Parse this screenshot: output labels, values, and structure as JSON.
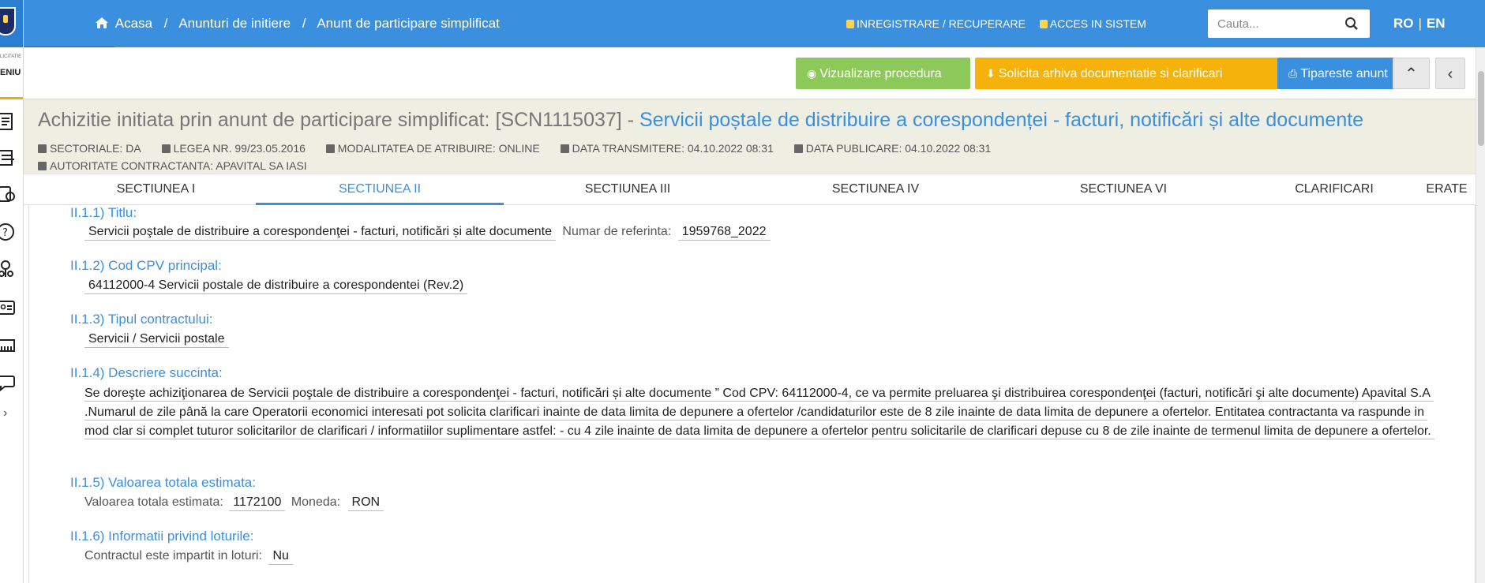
{
  "sidebar": {
    "top_label": "LICITATIE",
    "menu_label": "ENIU",
    "icons": [
      "document-icon",
      "list-icon",
      "tasks-icon",
      "help-icon",
      "tree-icon",
      "id-card-icon",
      "ruler-icon",
      "chat-icon"
    ],
    "expand": "›"
  },
  "topbar": {
    "breadcrumb": [
      {
        "label": "Acasa"
      },
      {
        "label": "Anunturi de initiere"
      },
      {
        "label": "Anunt de participare simplificat"
      }
    ],
    "separator": "/",
    "register_link": "INREGISTRARE / RECUPERARE",
    "login_link": "ACCES IN SISTEM",
    "search_placeholder": "Cauta...",
    "lang_ro": "RO",
    "lang_sep": "|",
    "lang_en": "EN"
  },
  "actions": {
    "view_procedure": "Vizualizare procedura",
    "request_archive": "Solicita arhiva documentatie si clarificari",
    "print_notice": "Tipareste anunt",
    "collapse": "⌃",
    "back": "‹"
  },
  "header": {
    "title_prefix": "Achizitie initiata prin anunt de participare simplificat: [SCN1115037] - ",
    "title_accent": "Servicii poștale de distribuire a corespondenței - facturi, notificări și alte documente",
    "meta_row1": [
      "SECTORIALE: DA",
      "LEGEA NR. 99/23.05.2016",
      "MODALITATEA DE ATRIBUIRE: ONLINE",
      "DATA TRANSMITERE: 04.10.2022 08:31",
      "DATA PUBLICARE: 04.10.2022 08:31"
    ],
    "meta_row2": "AUTORITATE CONTRACTANTA: APAVITAL SA IASI"
  },
  "tabs": [
    {
      "label": "SECTIUNEA I"
    },
    {
      "label": "SECTIUNEA II"
    },
    {
      "label": "SECTIUNEA III"
    },
    {
      "label": "SECTIUNEA IV"
    },
    {
      "label": "SECTIUNEA VI"
    },
    {
      "label": "CLARIFICARI"
    },
    {
      "label": "ERATE"
    }
  ],
  "section": {
    "title_label": "II.1.1) Titlu:",
    "title_value": "Servicii poştale de distribuire a corespondenţei - facturi, notificări și alte documente",
    "ref_label": "Numar de referinta:",
    "ref_value": "1959768_2022",
    "cpv_label": "II.1.2) Cod CPV principal:",
    "cpv_value": "64112000-4 Servicii postale de distribuire a corespondentei (Rev.2)",
    "type_label": "II.1.3) Tipul contractului:",
    "type_value": "Servicii / Servicii postale",
    "desc_label": "II.1.4) Descriere succinta:",
    "desc_value": " Se doreşte achiziţionarea de Servicii poştale de distribuire a corespondenţei - facturi, notificări și alte documente ” Cod CPV: 64112000-4, ce va permite preluarea şi distribuirea corespondenţei (facturi, notificări şi alte documente) Apavital S.A .Numarul de zile până la care Operatorii economici interesati pot solicita clarificari inainte de data limita de depunere a ofertelor /candidaturilor este de 8 zile inainte de data limita de depunere a ofertelor. Entitatea contractanta va raspunde in mod clar si complet tuturor solicitarilor de clarificari / informatiilor suplimentare astfel: - cu 4 zile inainte de data limita de depunere a ofertelor pentru solicitarile de clarificari depuse cu 8 de zile inainte de termenul limita de depunere a ofertelor. ",
    "value_label": "II.1.5) Valoarea totala estimata:",
    "value_text": "Valoarea totala estimata:",
    "value_amount": "1172100",
    "currency_label": "Moneda:",
    "currency_value": "RON",
    "lots_label": "II.1.6) Informatii privind loturile:",
    "lots_text": "Contractul este impartit in loturi:",
    "lots_value": "Nu"
  },
  "colors": {
    "primary": "#3a8fde",
    "green": "#8cc95a",
    "yellow": "#f5b20b",
    "header_bg": "#eeeee2"
  }
}
